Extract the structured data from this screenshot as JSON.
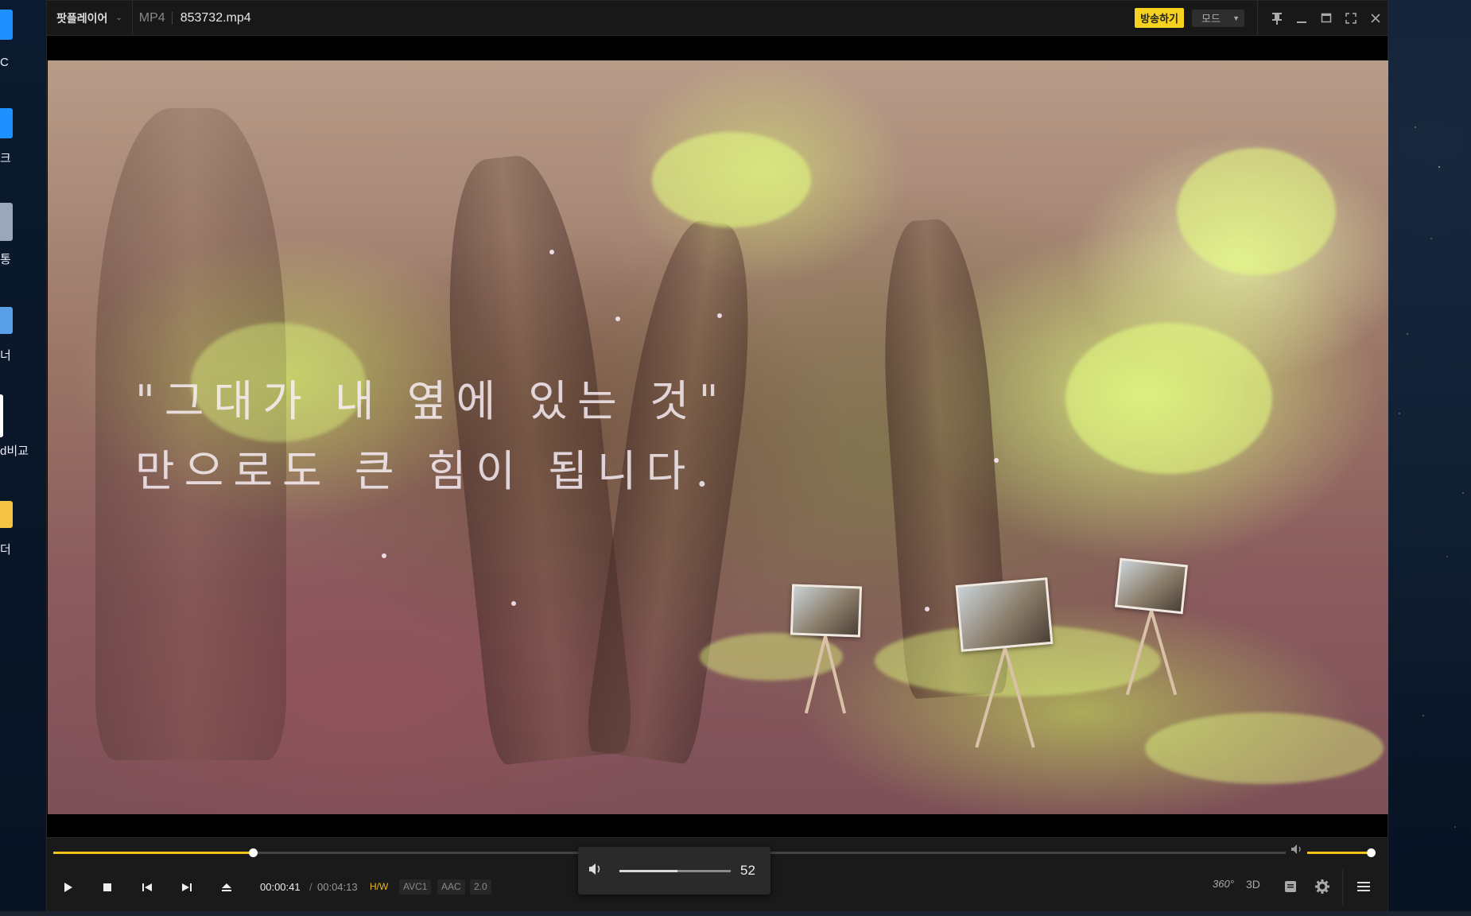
{
  "desktop": {
    "icons": [
      {
        "label": "C",
        "color": "#1e90ff"
      },
      {
        "label": "크",
        "color": "#1e90ff"
      },
      {
        "label": "통",
        "color": "#9aa7b8"
      },
      {
        "label": "너",
        "color": "#5aa0e8"
      },
      {
        "label": "d비교",
        "color": "#ffffff"
      },
      {
        "label": "더",
        "color": "#f6c445"
      }
    ]
  },
  "player": {
    "app_name": "팟플레이어",
    "format": "MP4",
    "filename": "853732.mp4",
    "broadcast_label": "방송하기",
    "mode_label": "모드",
    "caption_line1": "\"그대가 내 옆에 있는 것\"",
    "caption_line2": "만으로도 큰 힘이 됩니다.",
    "time_current": "00:00:41",
    "time_separator": "/",
    "time_total": "00:04:13",
    "progress_fraction": 0.162,
    "tags": {
      "hw": "H/W",
      "video_codec": "AVC1",
      "audio_codec": "AAC",
      "channels": "2.0"
    },
    "volume_value": "52",
    "volume_fraction": 0.52,
    "right_buttons": {
      "vr": "360°",
      "three_d": "3D"
    }
  },
  "colors": {
    "accent": "#f2c31b",
    "broadcast_bg": "#f5d21f"
  }
}
